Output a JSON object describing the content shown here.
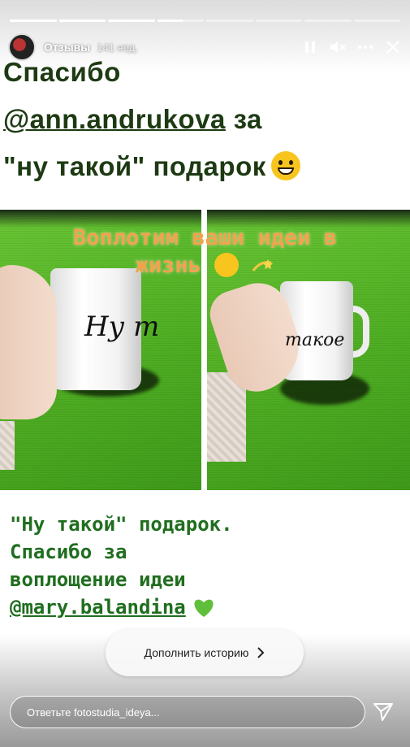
{
  "story": {
    "progress": [
      1,
      1,
      1,
      0.55,
      0,
      0,
      0,
      0
    ],
    "header": {
      "account": "Отзывы",
      "time": "141 нед."
    },
    "title_lines": {
      "line1": "Спасибо",
      "mention": "@ann.andrukova",
      "line2_suffix": " за",
      "line3": "\"ну такой\" подарок"
    },
    "photo_overlay": {
      "line1": "Воплотим ваши идеи в",
      "line2": "жизнь"
    },
    "mug_left_text": "Ну т",
    "mug_right_text": "такое",
    "bottom_text": {
      "line1": "\"Ну такой\" подарок.",
      "line2": "Спасибо за",
      "line3": "воплощение идеи",
      "mention": "@mary.balandina"
    },
    "add_story_label": "Дополнить историю",
    "reply_placeholder": "Ответьте fotostudia_ideya..."
  },
  "icons": {
    "pause": "pause-icon",
    "mute": "volume-muted-icon",
    "more": "more-dots-icon",
    "close": "close-icon",
    "send": "send-icon",
    "chevron": "chevron-right-icon"
  },
  "colors": {
    "title": "#1d3a12",
    "overlay_caption": "#f3a24b",
    "bottom_text": "#1f6e1f",
    "grass": "#5bb82b"
  }
}
